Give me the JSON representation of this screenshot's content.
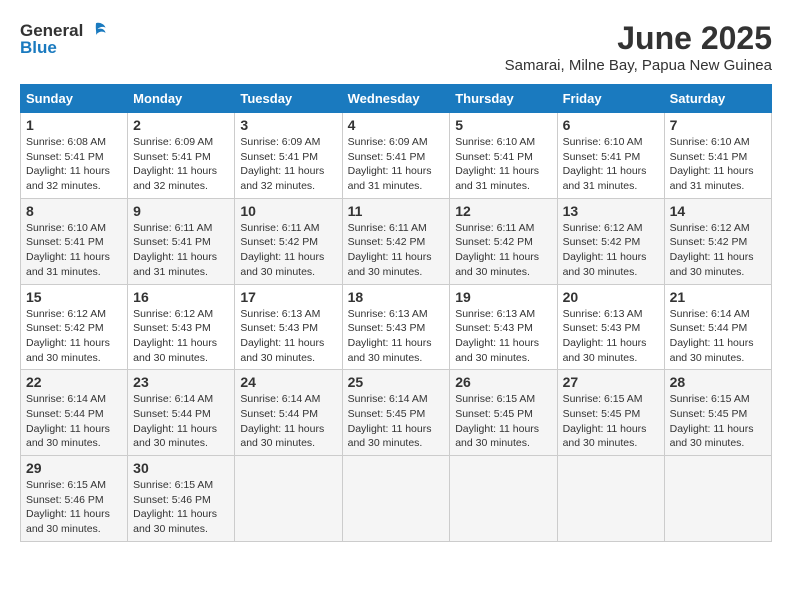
{
  "logo": {
    "general": "General",
    "blue": "Blue"
  },
  "title": "June 2025",
  "location": "Samarai, Milne Bay, Papua New Guinea",
  "days_of_week": [
    "Sunday",
    "Monday",
    "Tuesday",
    "Wednesday",
    "Thursday",
    "Friday",
    "Saturday"
  ],
  "weeks": [
    [
      {
        "day": "1",
        "sunrise": "6:08 AM",
        "sunset": "5:41 PM",
        "daylight": "11 hours and 32 minutes."
      },
      {
        "day": "2",
        "sunrise": "6:09 AM",
        "sunset": "5:41 PM",
        "daylight": "11 hours and 32 minutes."
      },
      {
        "day": "3",
        "sunrise": "6:09 AM",
        "sunset": "5:41 PM",
        "daylight": "11 hours and 32 minutes."
      },
      {
        "day": "4",
        "sunrise": "6:09 AM",
        "sunset": "5:41 PM",
        "daylight": "11 hours and 31 minutes."
      },
      {
        "day": "5",
        "sunrise": "6:10 AM",
        "sunset": "5:41 PM",
        "daylight": "11 hours and 31 minutes."
      },
      {
        "day": "6",
        "sunrise": "6:10 AM",
        "sunset": "5:41 PM",
        "daylight": "11 hours and 31 minutes."
      },
      {
        "day": "7",
        "sunrise": "6:10 AM",
        "sunset": "5:41 PM",
        "daylight": "11 hours and 31 minutes."
      }
    ],
    [
      {
        "day": "8",
        "sunrise": "6:10 AM",
        "sunset": "5:41 PM",
        "daylight": "11 hours and 31 minutes."
      },
      {
        "day": "9",
        "sunrise": "6:11 AM",
        "sunset": "5:41 PM",
        "daylight": "11 hours and 31 minutes."
      },
      {
        "day": "10",
        "sunrise": "6:11 AM",
        "sunset": "5:42 PM",
        "daylight": "11 hours and 30 minutes."
      },
      {
        "day": "11",
        "sunrise": "6:11 AM",
        "sunset": "5:42 PM",
        "daylight": "11 hours and 30 minutes."
      },
      {
        "day": "12",
        "sunrise": "6:11 AM",
        "sunset": "5:42 PM",
        "daylight": "11 hours and 30 minutes."
      },
      {
        "day": "13",
        "sunrise": "6:12 AM",
        "sunset": "5:42 PM",
        "daylight": "11 hours and 30 minutes."
      },
      {
        "day": "14",
        "sunrise": "6:12 AM",
        "sunset": "5:42 PM",
        "daylight": "11 hours and 30 minutes."
      }
    ],
    [
      {
        "day": "15",
        "sunrise": "6:12 AM",
        "sunset": "5:42 PM",
        "daylight": "11 hours and 30 minutes."
      },
      {
        "day": "16",
        "sunrise": "6:12 AM",
        "sunset": "5:43 PM",
        "daylight": "11 hours and 30 minutes."
      },
      {
        "day": "17",
        "sunrise": "6:13 AM",
        "sunset": "5:43 PM",
        "daylight": "11 hours and 30 minutes."
      },
      {
        "day": "18",
        "sunrise": "6:13 AM",
        "sunset": "5:43 PM",
        "daylight": "11 hours and 30 minutes."
      },
      {
        "day": "19",
        "sunrise": "6:13 AM",
        "sunset": "5:43 PM",
        "daylight": "11 hours and 30 minutes."
      },
      {
        "day": "20",
        "sunrise": "6:13 AM",
        "sunset": "5:43 PM",
        "daylight": "11 hours and 30 minutes."
      },
      {
        "day": "21",
        "sunrise": "6:14 AM",
        "sunset": "5:44 PM",
        "daylight": "11 hours and 30 minutes."
      }
    ],
    [
      {
        "day": "22",
        "sunrise": "6:14 AM",
        "sunset": "5:44 PM",
        "daylight": "11 hours and 30 minutes."
      },
      {
        "day": "23",
        "sunrise": "6:14 AM",
        "sunset": "5:44 PM",
        "daylight": "11 hours and 30 minutes."
      },
      {
        "day": "24",
        "sunrise": "6:14 AM",
        "sunset": "5:44 PM",
        "daylight": "11 hours and 30 minutes."
      },
      {
        "day": "25",
        "sunrise": "6:14 AM",
        "sunset": "5:45 PM",
        "daylight": "11 hours and 30 minutes."
      },
      {
        "day": "26",
        "sunrise": "6:15 AM",
        "sunset": "5:45 PM",
        "daylight": "11 hours and 30 minutes."
      },
      {
        "day": "27",
        "sunrise": "6:15 AM",
        "sunset": "5:45 PM",
        "daylight": "11 hours and 30 minutes."
      },
      {
        "day": "28",
        "sunrise": "6:15 AM",
        "sunset": "5:45 PM",
        "daylight": "11 hours and 30 minutes."
      }
    ],
    [
      {
        "day": "29",
        "sunrise": "6:15 AM",
        "sunset": "5:46 PM",
        "daylight": "11 hours and 30 minutes."
      },
      {
        "day": "30",
        "sunrise": "6:15 AM",
        "sunset": "5:46 PM",
        "daylight": "11 hours and 30 minutes."
      },
      null,
      null,
      null,
      null,
      null
    ]
  ]
}
